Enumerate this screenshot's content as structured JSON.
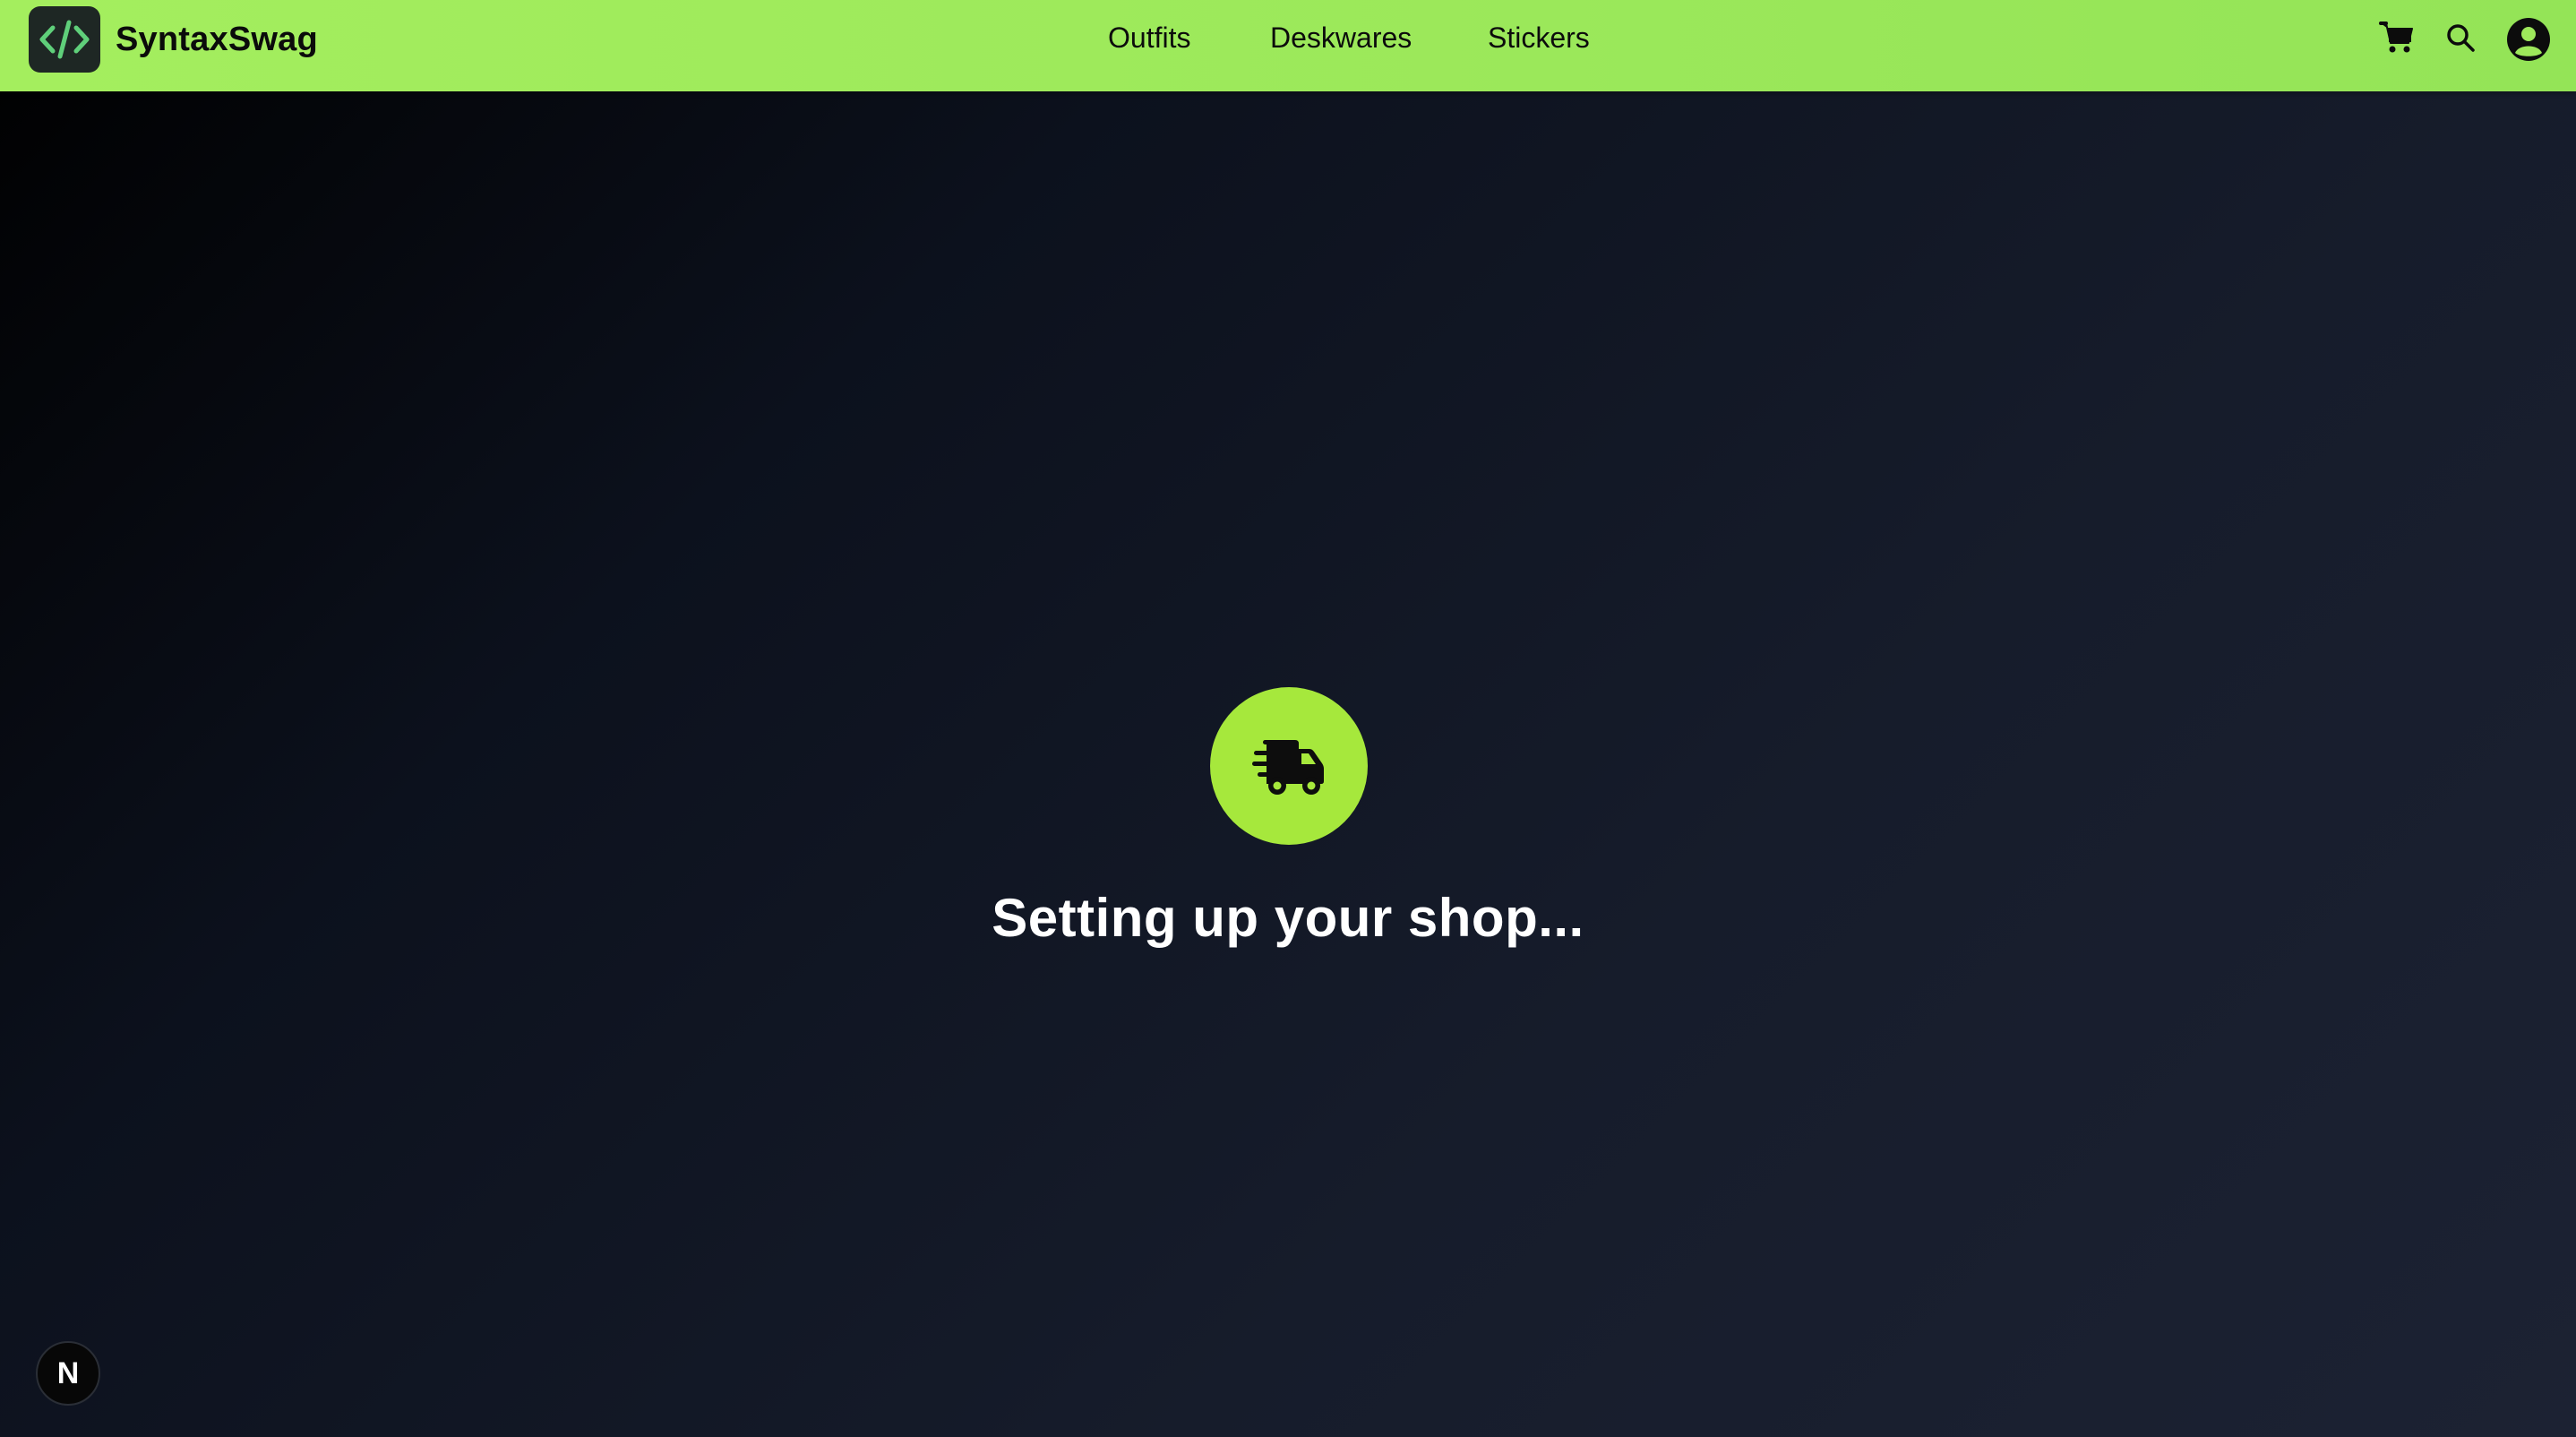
{
  "header": {
    "brand_name": "SyntaxSwag",
    "logo_icon": "code-icon",
    "nav": [
      {
        "label": "Outfits"
      },
      {
        "label": "Deskwares"
      },
      {
        "label": "Stickers"
      }
    ],
    "actions": [
      {
        "icon": "cart-icon"
      },
      {
        "icon": "search-icon"
      },
      {
        "icon": "user-account-icon"
      }
    ],
    "colors": {
      "bar": "#9de85b",
      "logo_bg": "#1e2724",
      "logo_glyph": "#5fcf7a"
    }
  },
  "main": {
    "status_icon": "delivery-truck-icon",
    "status_text": "Setting up your shop...",
    "colors": {
      "badge": "#a6e83c",
      "background_start": "#000000",
      "background_end": "#1c2233"
    }
  },
  "dev_indicator": {
    "label": "N",
    "icon": "nextjs-icon"
  }
}
